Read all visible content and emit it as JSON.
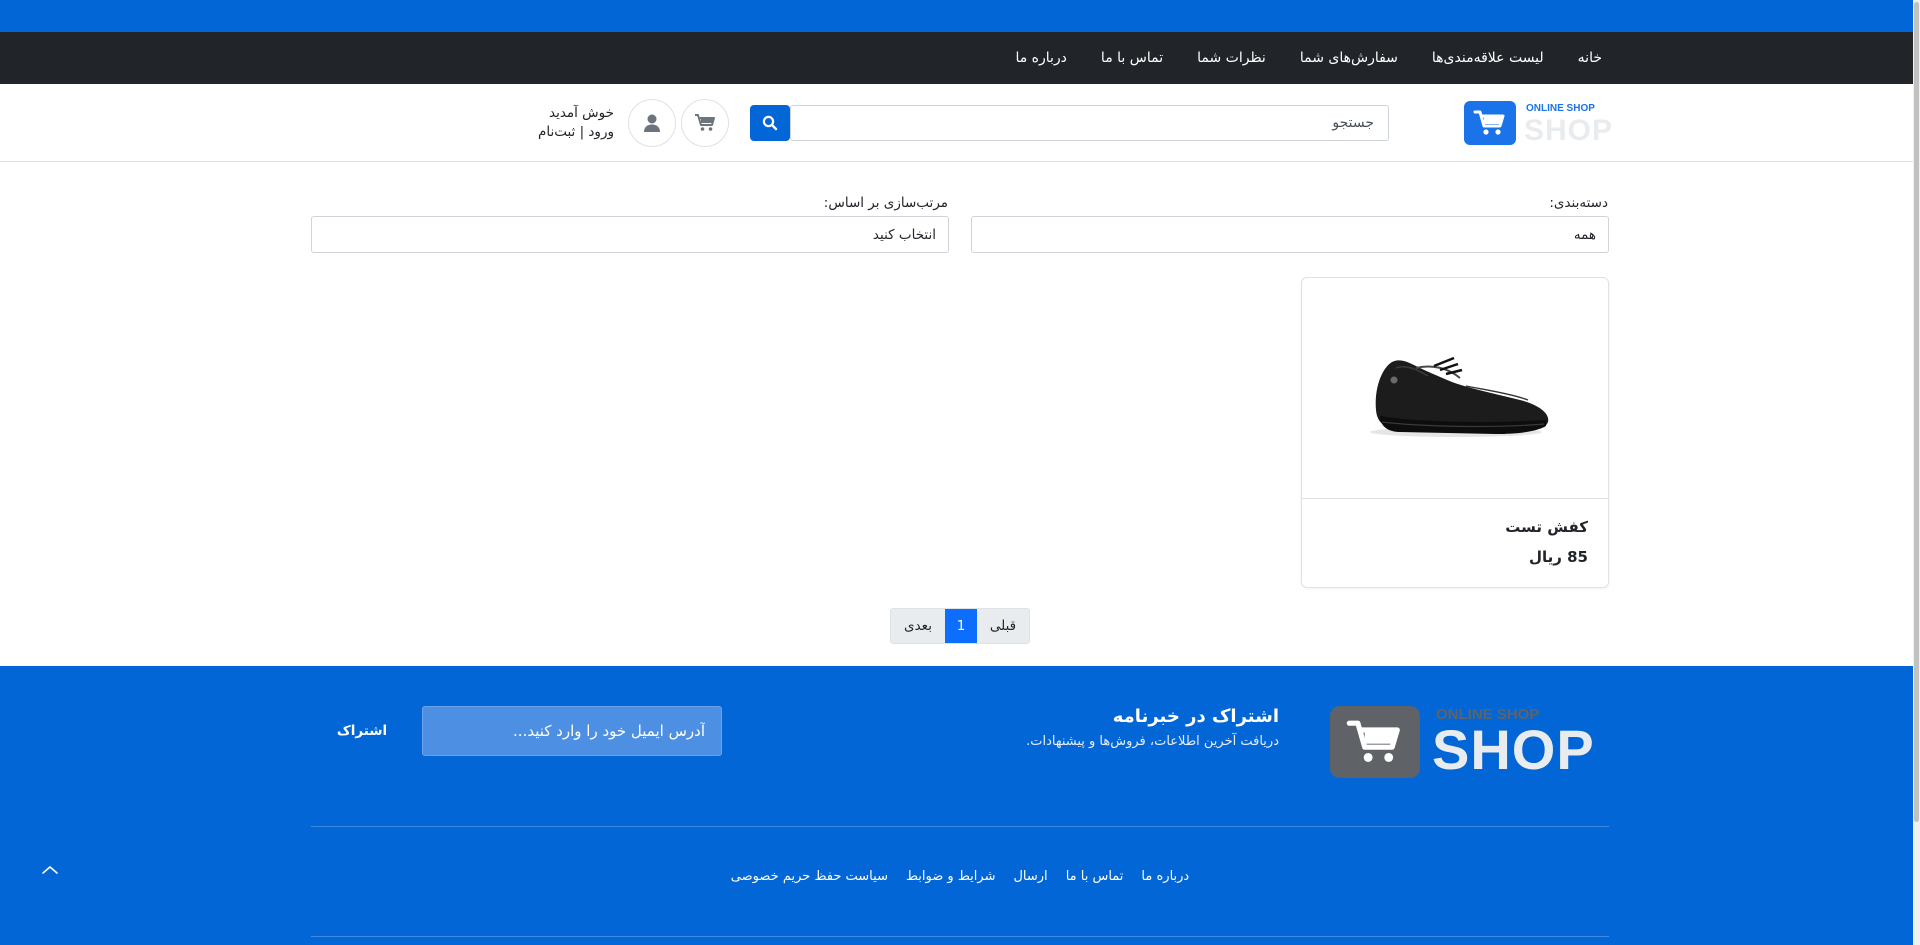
{
  "nav": {
    "items": [
      {
        "label": "خانه"
      },
      {
        "label": "لیست علاقه‌مندی‌ها"
      },
      {
        "label": "سفارش‌های شما"
      },
      {
        "label": "نظرات شما"
      },
      {
        "label": "تماس با ما"
      },
      {
        "label": "درباره ما"
      }
    ]
  },
  "header": {
    "logo_online": "ONLINE SHOP",
    "logo_shop": "SHOP",
    "search_placeholder": "جستجو",
    "welcome": "خوش آمدید",
    "auth_link": "ورود | ثبت‌نام"
  },
  "filters": {
    "category_label": "دسته‌بندی:",
    "category_value": "همه",
    "sort_label": "مرتب‌سازی بر اساس:",
    "sort_value": "انتخاب کنید"
  },
  "products": [
    {
      "name": "کفش تست",
      "price": "85 ریال",
      "image_icon": "shoe-image"
    }
  ],
  "pagination": {
    "prev": "قبلی",
    "current": "1",
    "next": "بعدی"
  },
  "footer": {
    "logo_online": "ONLINE SHOP",
    "logo_shop": "SHOP",
    "newsletter_title": "اشتراک در خبرنامه",
    "newsletter_desc": "دریافت آخرین اطلاعات، فروش‌ها و پیشنهادات.",
    "email_placeholder": "آدرس ایمیل خود را وارد کنید...",
    "subscribe_label": "اشتراک",
    "links": [
      {
        "label": "درباره ما"
      },
      {
        "label": "تماس با ما"
      },
      {
        "label": "ارسال"
      },
      {
        "label": "شرایط و ضوابط"
      },
      {
        "label": "سیاست حفظ حریم خصوصی"
      }
    ]
  },
  "colors": {
    "primary": "#0366d6",
    "navbar": "#212529",
    "active_page": "#0d6efd"
  }
}
